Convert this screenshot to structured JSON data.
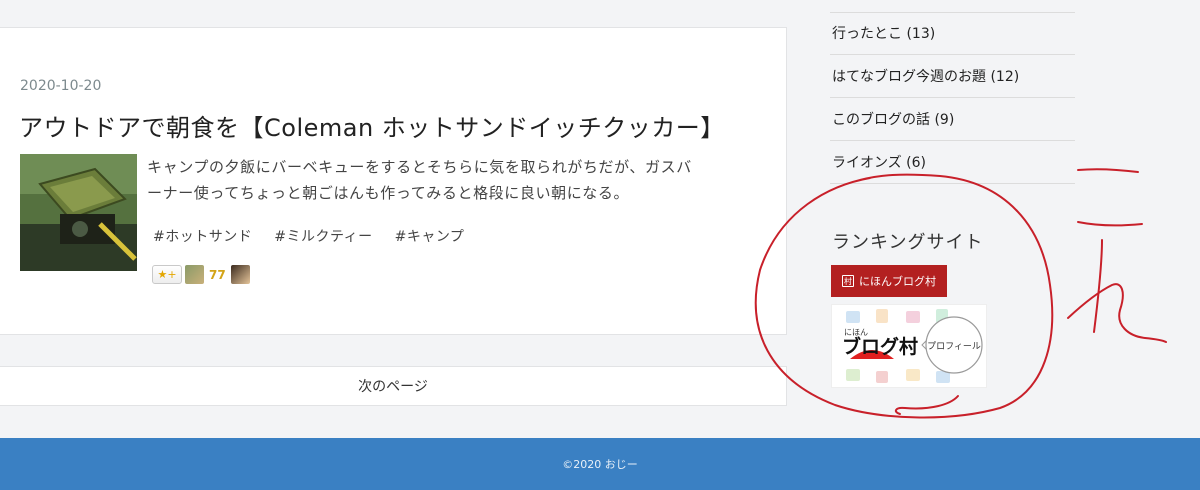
{
  "post": {
    "date": "2020-10-20",
    "title": "アウトドアで朝食を【Coleman ホットサンドイッチクッカー】",
    "excerpt_line1": "キャンプの夕飯にバーベキューをするとそちらに気を取られがちだが、ガスバ",
    "excerpt_line2": "ーナー使ってちょっと朝ごはんも作ってみると格段に良い朝になる。",
    "tags": [
      "#ホットサンド",
      "#ミルクティー",
      "#キャンプ"
    ],
    "star_button": "★+",
    "star_count": "77"
  },
  "pager": {
    "next_label": "次のページ"
  },
  "sidebar": {
    "categories": [
      "行ったとこ (13)",
      "はてなブログ今週のお題 (12)",
      "このブログの話 (9)",
      "ライオンズ (6)"
    ],
    "ranking_title": "ランキングサイト",
    "nihon_button": "にほんブログ村",
    "nihon_icon": "村",
    "banner_small": "にほん",
    "banner_main": "ブログ村",
    "banner_profile": "プロフィール"
  },
  "footer": {
    "copyright": "©2020 おじー"
  },
  "annotation": {
    "handwriting": "これ"
  },
  "colors": {
    "footer": "#3a80c3",
    "nihon_red": "#b32020",
    "annotation_red": "#c8202a",
    "date_gray": "#7d8a8e"
  }
}
